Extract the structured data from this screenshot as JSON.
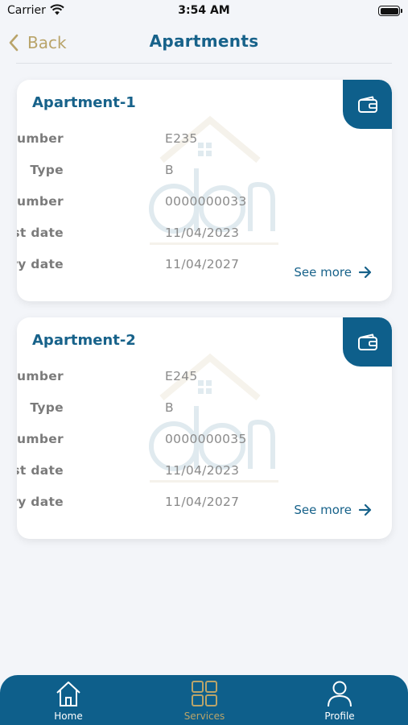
{
  "status_bar": {
    "carrier": "Carrier",
    "time": "3:54 AM"
  },
  "nav": {
    "back_label": "Back",
    "title": "Apartments"
  },
  "apartments": [
    {
      "title": "Apartment-1",
      "fields": [
        {
          "label": "Number",
          "value": "E235"
        },
        {
          "label": "Type",
          "value": "B"
        },
        {
          "label": "Request number",
          "value": "0000000033"
        },
        {
          "label": "Request date",
          "value": "11/04/2023"
        },
        {
          "label": "Delivery date",
          "value": "11/04/2027"
        }
      ],
      "see_more": "See more"
    },
    {
      "title": "Apartment-2",
      "fields": [
        {
          "label": "Number",
          "value": "E245"
        },
        {
          "label": "Type",
          "value": "B"
        },
        {
          "label": "Request number",
          "value": "0000000035"
        },
        {
          "label": "Request date",
          "value": "11/04/2023"
        },
        {
          "label": "Delivery date",
          "value": "11/04/2027"
        }
      ],
      "see_more": "See more"
    }
  ],
  "tab_bar": {
    "items": [
      {
        "label": "Home",
        "icon": "home-icon",
        "active": false
      },
      {
        "label": "Services",
        "icon": "grid-icon",
        "active": true
      },
      {
        "label": "Profile",
        "icon": "person-icon",
        "active": false
      }
    ]
  },
  "colors": {
    "primary": "#0e5f8b",
    "accent": "#b9a46a",
    "background": "#f3f5f9"
  }
}
